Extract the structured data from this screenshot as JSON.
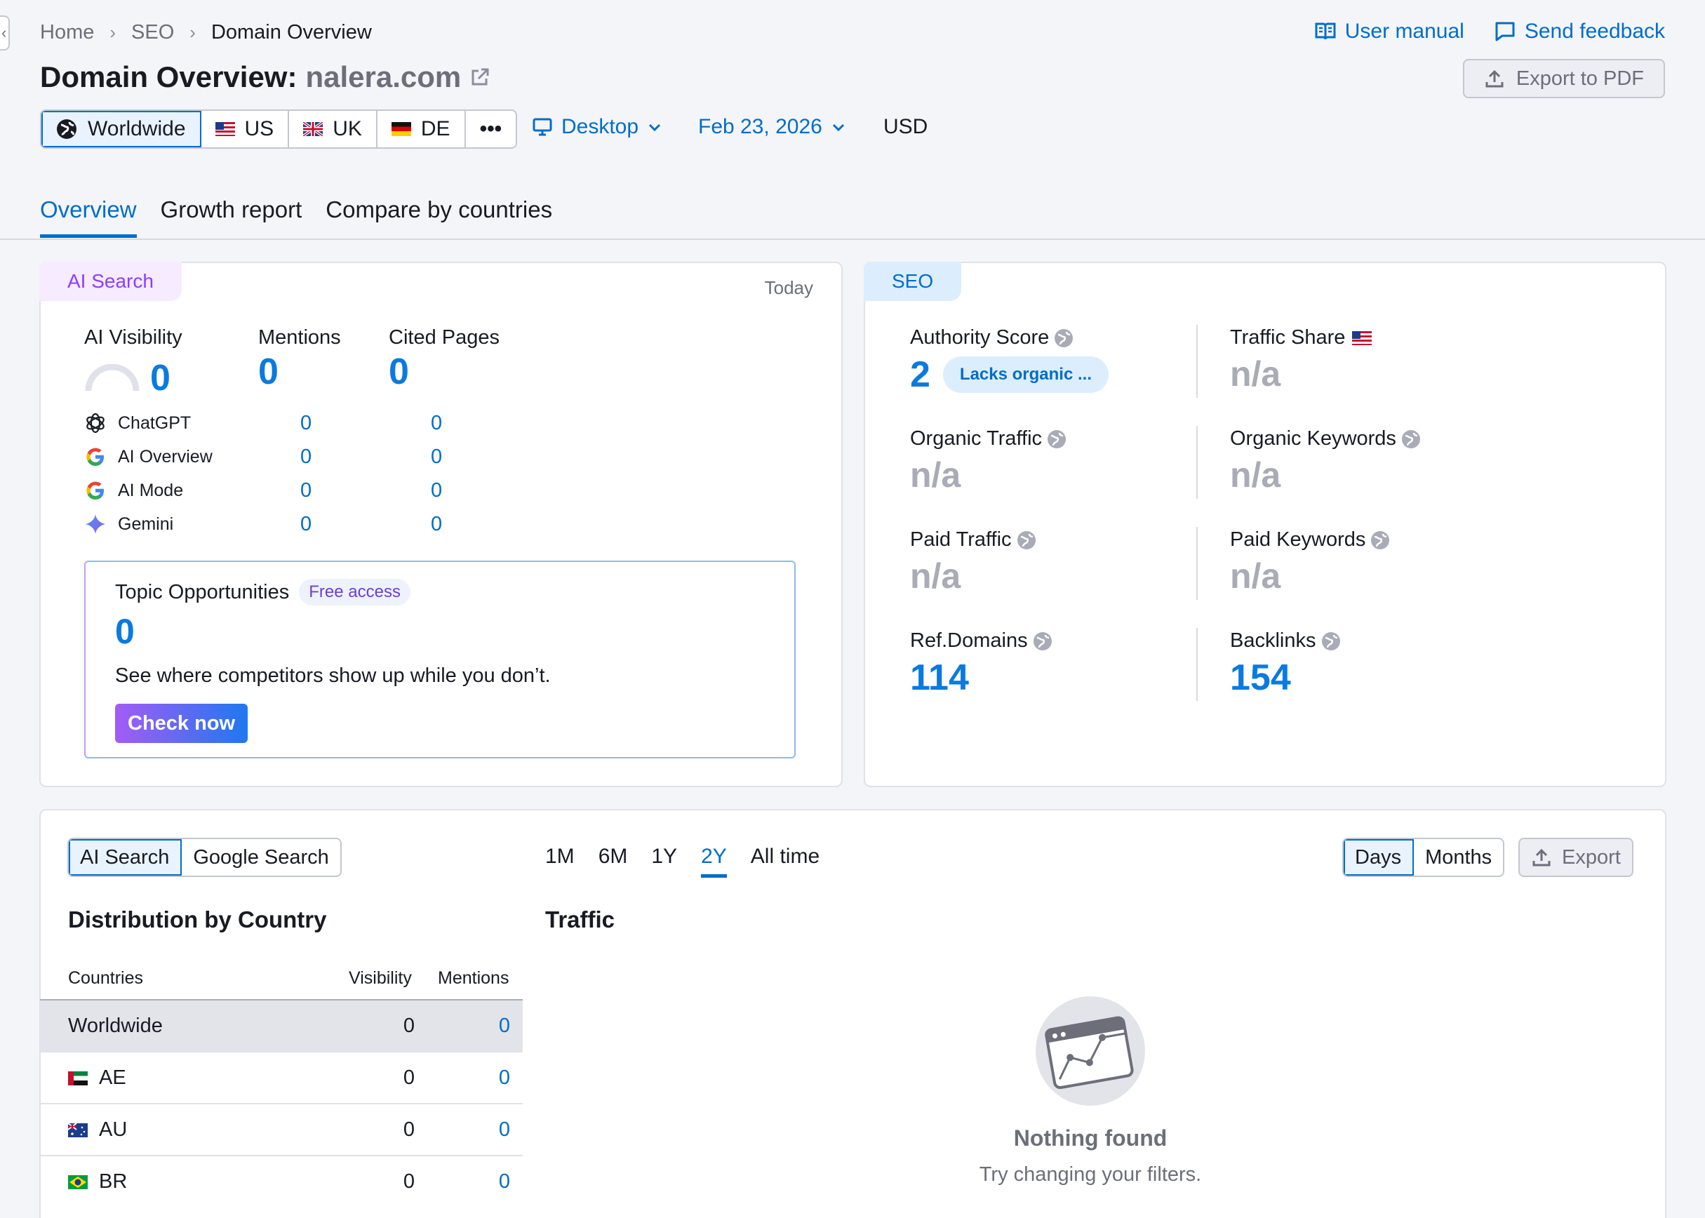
{
  "breadcrumb": {
    "items": [
      "Home",
      "SEO",
      "Domain Overview"
    ]
  },
  "header": {
    "title_prefix": "Domain Overview:",
    "domain": "nalera.com",
    "user_manual": "User manual",
    "send_feedback": "Send feedback",
    "export_pdf": "Export to PDF"
  },
  "regions": [
    {
      "label": "Worldwide",
      "active": true
    },
    {
      "label": "US"
    },
    {
      "label": "UK"
    },
    {
      "label": "DE"
    },
    {
      "label": "•••"
    }
  ],
  "device": "Desktop",
  "date": "Feb 23, 2026",
  "currency": "USD",
  "tabs": [
    "Overview",
    "Growth report",
    "Compare by countries"
  ],
  "ai_card": {
    "badge": "AI Search",
    "period": "Today",
    "visibility_label": "AI Visibility",
    "visibility_value": "0",
    "mentions_label": "Mentions",
    "mentions_value": "0",
    "cited_label": "Cited Pages",
    "cited_value": "0",
    "models": [
      {
        "name": "ChatGPT",
        "mentions": "0",
        "cited": "0"
      },
      {
        "name": "AI Overview",
        "mentions": "0",
        "cited": "0"
      },
      {
        "name": "AI Mode",
        "mentions": "0",
        "cited": "0"
      },
      {
        "name": "Gemini",
        "mentions": "0",
        "cited": "0"
      }
    ],
    "topic": {
      "title": "Topic Opportunities",
      "badge": "Free access",
      "value": "0",
      "text": "See where competitors show up while you don’t.",
      "button": "Check now"
    }
  },
  "seo_card": {
    "badge": "SEO",
    "authority_label": "Authority Score",
    "authority_value": "2",
    "authority_pill": "Lacks organic ...",
    "traffic_share_label": "Traffic Share",
    "traffic_share_value": "n/a",
    "organic_traffic_label": "Organic Traffic",
    "organic_traffic_value": "n/a",
    "organic_keywords_label": "Organic Keywords",
    "organic_keywords_value": "n/a",
    "paid_traffic_label": "Paid Traffic",
    "paid_traffic_value": "n/a",
    "paid_keywords_label": "Paid Keywords",
    "paid_keywords_value": "n/a",
    "ref_domains_label": "Ref.Domains",
    "ref_domains_value": "114",
    "backlinks_label": "Backlinks",
    "backlinks_value": "154"
  },
  "bottom": {
    "source_toggle": [
      "AI Search",
      "Google Search"
    ],
    "periods": [
      "1M",
      "6M",
      "1Y",
      "2Y",
      "All time"
    ],
    "active_period": "2Y",
    "granularity": [
      "Days",
      "Months"
    ],
    "export": "Export",
    "distribution_title": "Distribution by Country",
    "traffic_title": "Traffic",
    "table_headers": [
      "Countries",
      "Visibility",
      "Mentions"
    ],
    "rows": [
      {
        "country": "Worldwide",
        "visibility": "0",
        "mentions": "0"
      },
      {
        "country": "AE",
        "visibility": "0",
        "mentions": "0"
      },
      {
        "country": "AU",
        "visibility": "0",
        "mentions": "0"
      },
      {
        "country": "BR",
        "visibility": "0",
        "mentions": "0"
      }
    ],
    "empty_title": "Nothing found",
    "empty_text": "Try changing your filters."
  }
}
